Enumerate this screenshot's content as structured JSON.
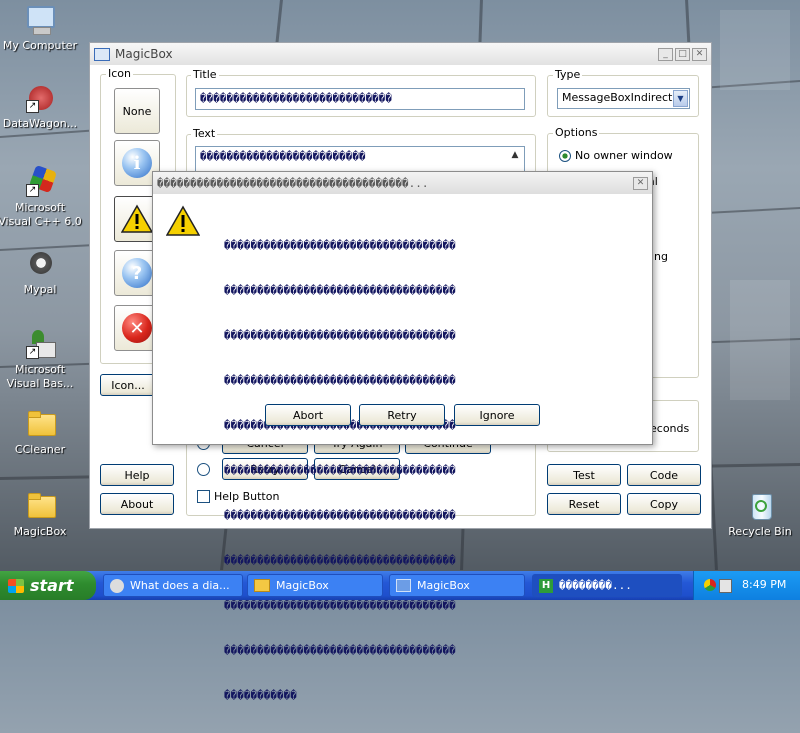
{
  "desktop": {
    "icons": [
      {
        "label": "My Computer"
      },
      {
        "label": "DataWagon..."
      },
      {
        "label": "Microsoft Visual C++ 6.0"
      },
      {
        "label": "Mypal"
      },
      {
        "label": "Microsoft Visual Bas..."
      },
      {
        "label": "CCleaner"
      },
      {
        "label": "MagicBox"
      },
      {
        "label": "Recycle Bin"
      }
    ]
  },
  "magicbox": {
    "title": "MagicBox",
    "icon_group_label": "Icon",
    "icon_buttons": {
      "none": "None",
      "custom": "Icon..."
    },
    "title_group_label": "Title",
    "title_value": "�����������������������������",
    "text_group_label": "Text",
    "text_value": "�������������������������",
    "type_group_label": "Type",
    "type_value": "MessageBoxIndirect",
    "options_group_label": "Options",
    "options": [
      "No owner window",
      "al",
      "ing"
    ],
    "seconds_suffix": "econds",
    "button_rows": {
      "row1": [
        "Cancel",
        "Try Again",
        "Continue"
      ],
      "row2": [
        "Retry",
        "Cancel"
      ]
    },
    "help_checkbox": "Help Button",
    "left_buttons": {
      "help": "Help",
      "about": "About"
    },
    "right_buttons": {
      "test": "Test",
      "code": "Code",
      "reset": "Reset",
      "copy": "Copy"
    }
  },
  "message_box": {
    "title": "��������������������������������������...",
    "icon": "warning-icon",
    "body_lines": [
      "�����������������������������������",
      "�����������������������������������",
      "�����������������������������������",
      "�����������������������������������",
      "�����������������������������������",
      "�����������������������������������",
      "�����������������������������������",
      "�����������������������������������",
      "�����������������������������������",
      "�����������������������������������",
      "�����������"
    ],
    "buttons": {
      "abort": "Abort",
      "retry": "Retry",
      "ignore": "Ignore"
    }
  },
  "taskbar": {
    "start": "start",
    "tasks": [
      {
        "label": "What does a dia..."
      },
      {
        "label": "MagicBox"
      },
      {
        "label": "MagicBox"
      },
      {
        "label": "��������..."
      }
    ],
    "clock": "8:49 PM"
  },
  "colors": {
    "accent": "#1e4fcc",
    "garbled_text": "#13165f",
    "warning": "#f5d000",
    "error": "#d9261c"
  }
}
